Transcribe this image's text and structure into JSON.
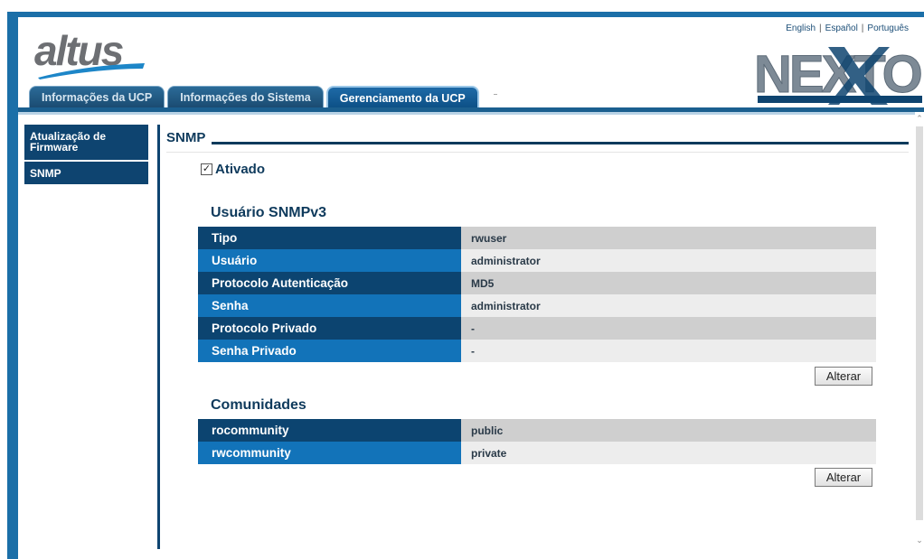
{
  "header": {
    "logo_text": "altus",
    "brand_text": "NEXTO",
    "languages": [
      "English",
      "Español",
      "Português"
    ]
  },
  "tabs": [
    {
      "label": "Informações da UCP"
    },
    {
      "label": "Informações do Sistema"
    },
    {
      "label": "Gerenciamento da UCP"
    }
  ],
  "sidebar": {
    "items": [
      {
        "label": "Atualização de Firmware"
      },
      {
        "label": "SNMP"
      }
    ]
  },
  "main": {
    "section_title": "SNMP",
    "enabled_label": "Ativado",
    "enabled_checked": true,
    "snmpv3": {
      "title": "Usuário SNMPv3",
      "rows": [
        {
          "key": "Tipo",
          "value": "rwuser"
        },
        {
          "key": "Usuário",
          "value": "administrator"
        },
        {
          "key": "Protocolo Autenticação",
          "value": "MD5"
        },
        {
          "key": "Senha",
          "value": "administrator"
        },
        {
          "key": "Protocolo Privado",
          "value": "-"
        },
        {
          "key": "Senha Privado",
          "value": "-"
        }
      ],
      "button_label": "Alterar"
    },
    "communities": {
      "title": "Comunidades",
      "rows": [
        {
          "key": "rocommunity",
          "value": "public"
        },
        {
          "key": "rwcommunity",
          "value": "private"
        }
      ],
      "button_label": "Alterar"
    }
  },
  "colors": {
    "primary_dark": "#0c4470",
    "primary_light": "#1273b9",
    "frame_blue": "#1b6fa8"
  }
}
